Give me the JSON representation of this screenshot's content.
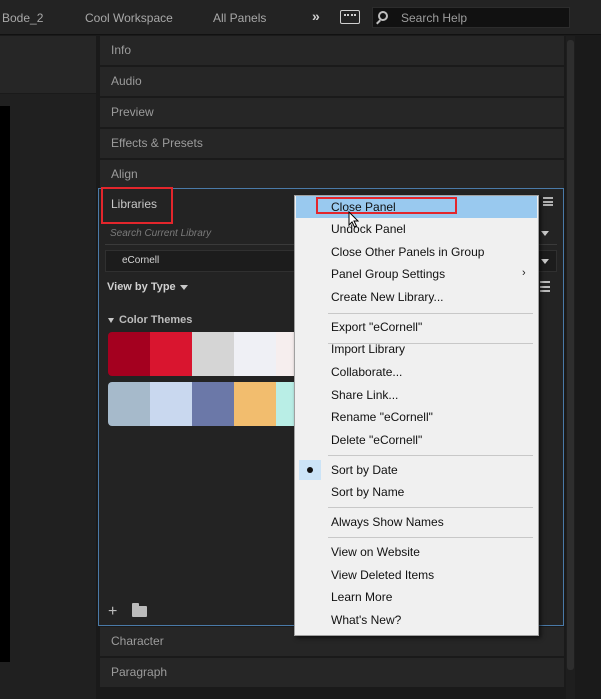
{
  "workspace_bar": {
    "tabs": [
      "Bode_2",
      "Cool Workspace",
      "All Panels"
    ],
    "overflow_glyph": "»",
    "search_placeholder": "Search Help"
  },
  "panels": {
    "collapsed_top": [
      "Info",
      "Audio",
      "Preview",
      "Effects & Presets",
      "Align"
    ],
    "collapsed_bottom": [
      "Character",
      "Paragraph"
    ]
  },
  "libraries": {
    "title": "Libraries",
    "search_placeholder": "Search Current Library",
    "selected_library": "eCornell",
    "view_by": "View by Type",
    "section": "Color Themes",
    "theme_rows": [
      [
        "#a4001f",
        "#d9152f",
        "#d5d5d5",
        "#eff0f5",
        "#f6eeee"
      ],
      [
        "#a6bacb",
        "#c9d8ef",
        "#6b78a8",
        "#f2bd6e",
        "#b9eee6"
      ]
    ],
    "footer_plus": "+"
  },
  "context_menu": {
    "items": [
      {
        "label": "Close Panel",
        "highlighted": true
      },
      {
        "label": "Undock Panel"
      },
      {
        "label": "Close Other Panels in Group"
      },
      {
        "label": "Panel Group Settings",
        "submenu": "›"
      },
      {
        "label": "Create New Library..."
      },
      {
        "label": "Export \"eCornell\""
      },
      {
        "label": "Import Library"
      },
      {
        "label": "Collaborate..."
      },
      {
        "label": "Share Link..."
      },
      {
        "label": "Rename \"eCornell\""
      },
      {
        "label": "Delete \"eCornell\""
      },
      {
        "label": "Sort by Date",
        "checked": true
      },
      {
        "label": "Sort by Name"
      },
      {
        "label": "Always Show Names"
      },
      {
        "label": "View on Website"
      },
      {
        "label": "View Deleted Items"
      },
      {
        "label": "Learn More"
      },
      {
        "label": "What's New?"
      }
    ]
  },
  "colors": {
    "highlight": "#99c9ef",
    "annotation_red": "#e3262c",
    "panel_focus_border": "#4a7aa8"
  }
}
